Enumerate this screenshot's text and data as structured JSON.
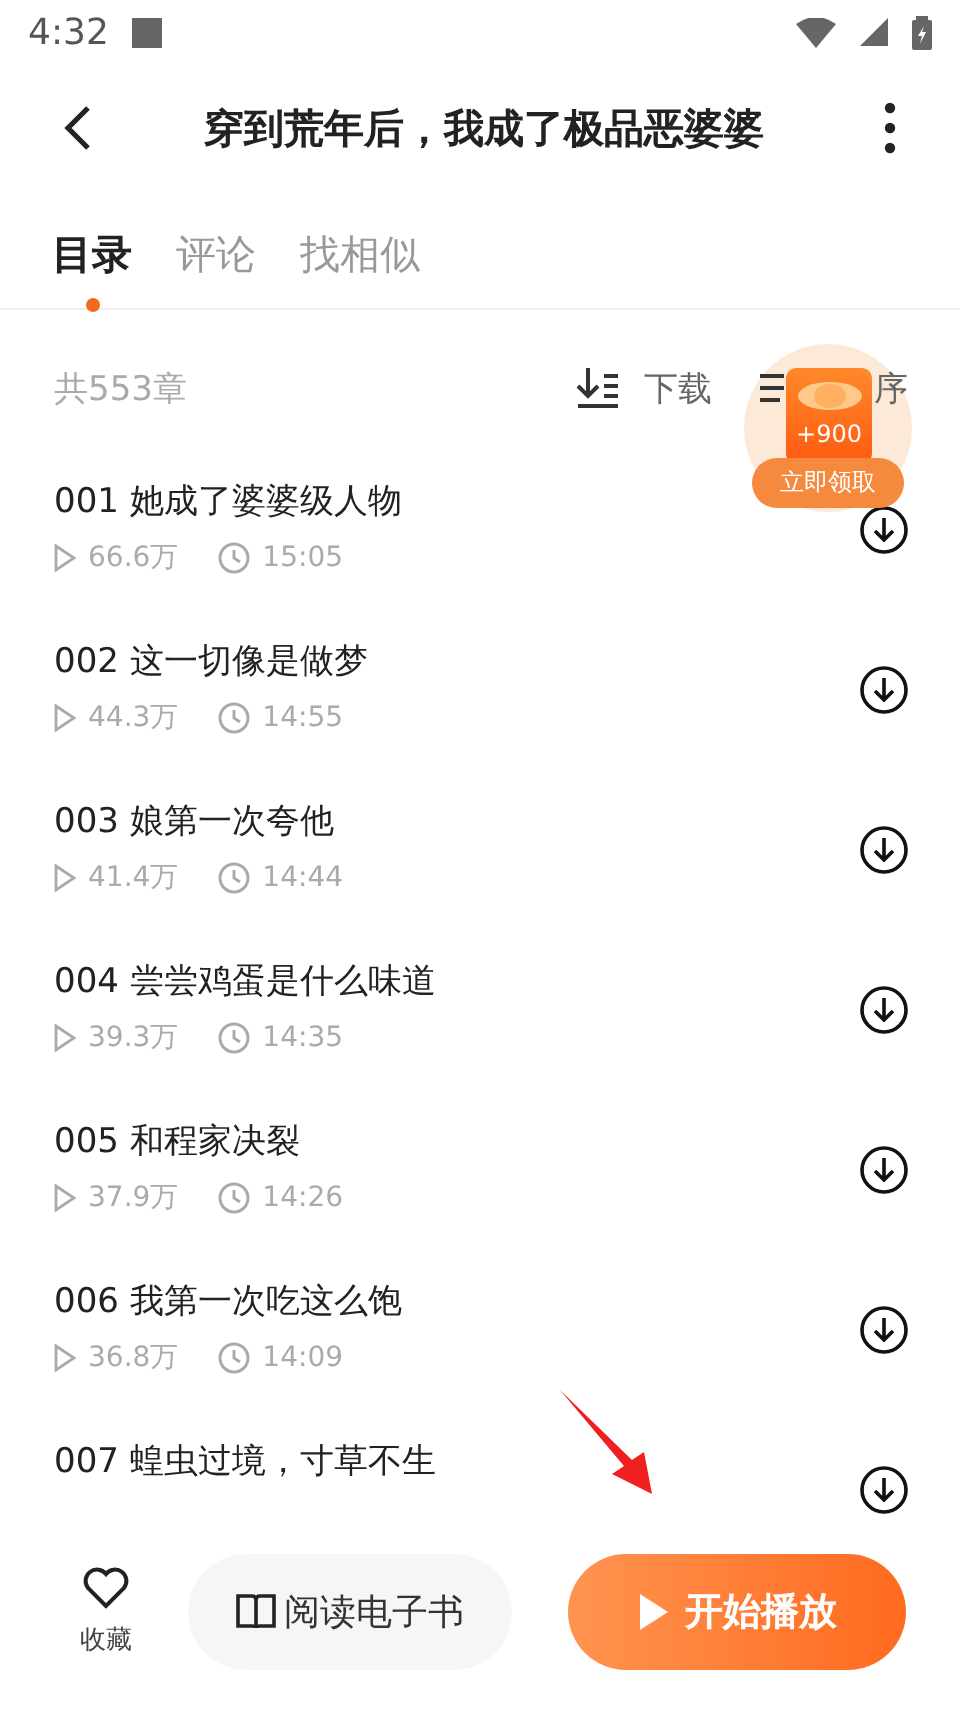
{
  "status_bar": {
    "time": "4:32"
  },
  "header": {
    "title": "穿到荒年后，我成了极品恶婆婆"
  },
  "tabs": [
    {
      "label": "目录",
      "selected": true
    },
    {
      "label": "评论",
      "selected": false
    },
    {
      "label": "找相似",
      "selected": false
    }
  ],
  "toolbar": {
    "count": "共553章",
    "download": "下载",
    "sort": "序"
  },
  "reward_badge": {
    "amount": "+900",
    "action": "立即领取"
  },
  "chapters": [
    {
      "title": "001 她成了婆婆级人物",
      "plays": "66.6万",
      "duration": "15:05"
    },
    {
      "title": "002 这一切像是做梦",
      "plays": "44.3万",
      "duration": "14:55"
    },
    {
      "title": "003 娘第一次夸他",
      "plays": "41.4万",
      "duration": "14:44"
    },
    {
      "title": "004 尝尝鸡蛋是什么味道",
      "plays": "39.3万",
      "duration": "14:35"
    },
    {
      "title": "005 和程家决裂",
      "plays": "37.9万",
      "duration": "14:26"
    },
    {
      "title": "006 我第一次吃这么饱",
      "plays": "36.8万",
      "duration": "14:09"
    },
    {
      "title": "007 蝗虫过境，寸草不生"
    }
  ],
  "bottom_bar": {
    "favorite": "收藏",
    "read_ebook": "阅读电子书",
    "play": "开始播放"
  }
}
